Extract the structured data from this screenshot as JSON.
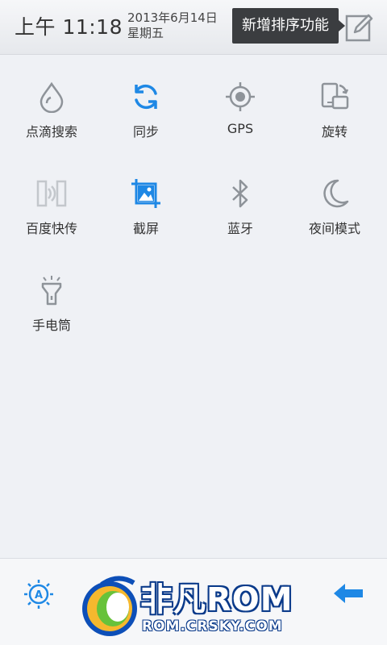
{
  "status": {
    "time": "上午 11:18",
    "date": "2013年6月14日",
    "weekday": "星期五",
    "tooltip": "新增排序功能",
    "edit_icon": "edit-icon"
  },
  "toggles": [
    {
      "label": "点滴搜索",
      "icon": "droplet-icon"
    },
    {
      "label": "同步",
      "icon": "sync-icon",
      "active": true
    },
    {
      "label": "GPS",
      "icon": "gps-icon"
    },
    {
      "label": "旋转",
      "icon": "rotate-icon"
    },
    {
      "label": "百度快传",
      "icon": "baidu-transfer-icon"
    },
    {
      "label": "截屏",
      "icon": "screenshot-icon",
      "active": true
    },
    {
      "label": "蓝牙",
      "icon": "bluetooth-icon"
    },
    {
      "label": "夜间模式",
      "icon": "moon-icon"
    },
    {
      "label": "手电筒",
      "icon": "flashlight-icon"
    }
  ],
  "bottom": {
    "brightness_icon": "auto-brightness-icon",
    "back_icon": "back-arrow-icon",
    "watermark_line1": "非凡ROM",
    "watermark_line2": "ROM.CRSKY.COM"
  },
  "colors": {
    "accent": "#1e88e5",
    "icon_gray": "#8e9399",
    "background": "#eff1f5",
    "tooltip_bg": "#3b3d40"
  }
}
